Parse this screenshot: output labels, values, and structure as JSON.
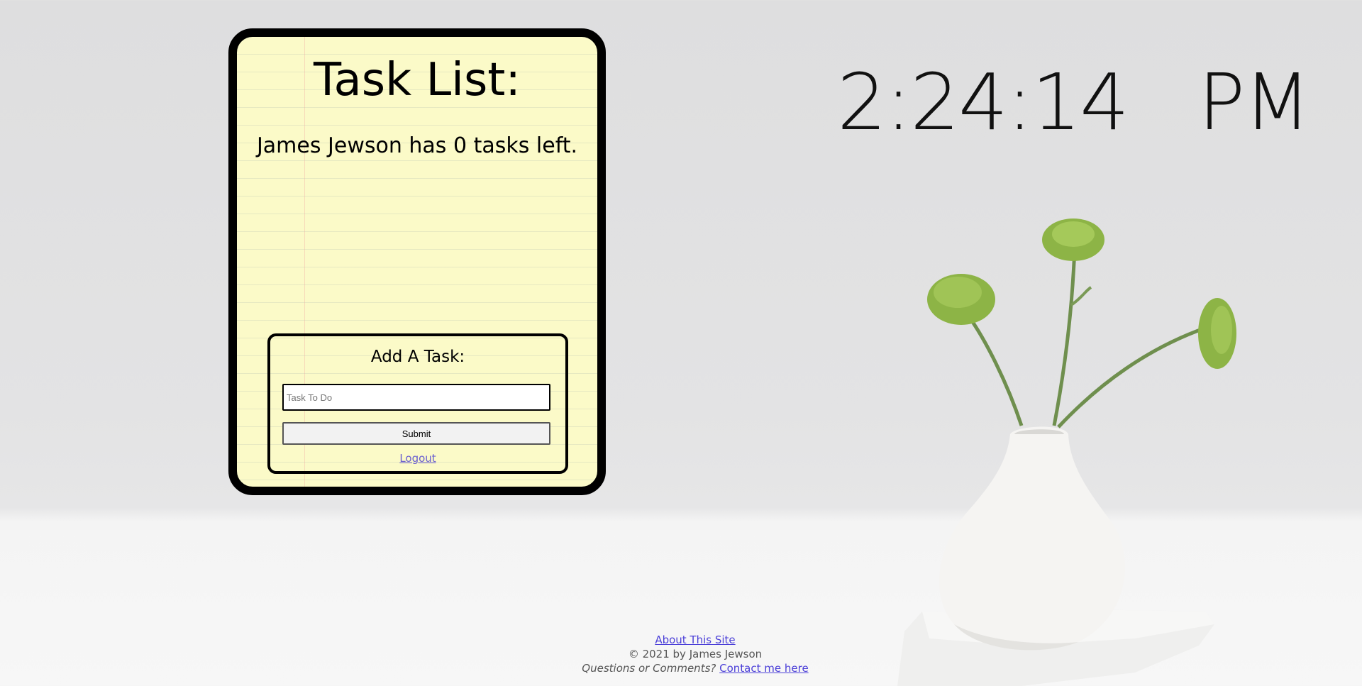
{
  "card": {
    "title": "Task List:",
    "task_count_text": "James Jewson has 0 tasks left."
  },
  "add_task": {
    "heading": "Add A Task:",
    "input_placeholder": "Task To Do",
    "input_value": "",
    "submit_label": "Submit",
    "logout_label": "Logout"
  },
  "clock": {
    "time_text": "2:24:14   PM"
  },
  "footer": {
    "about_label": "About This Site",
    "copyright_text": "© 2021 by James Jewson",
    "questions_text": "Questions or Comments?",
    "contact_label": "Contact me here"
  },
  "colors": {
    "card_background": "#fbfac8",
    "card_border": "#000000",
    "link": "#4b3fd8"
  }
}
